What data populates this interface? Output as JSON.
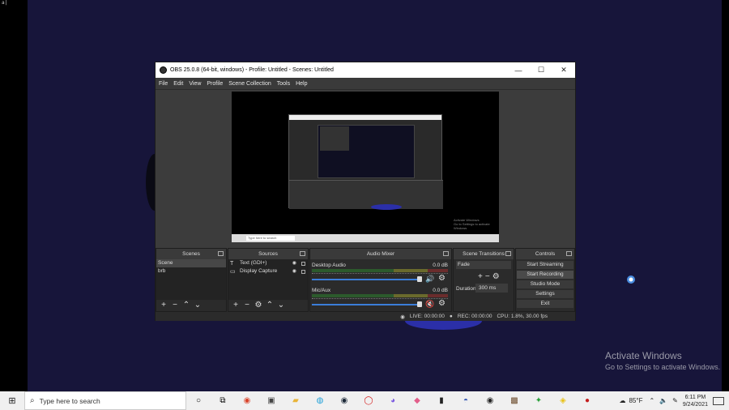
{
  "screen_corner_text": "a|",
  "window": {
    "title": "OBS 25.0.8 (64-bit, windows) - Profile: Untitled - Scenes: Untitled",
    "minimize": "—",
    "maximize": "☐",
    "close": "✕"
  },
  "menu": [
    "File",
    "Edit",
    "View",
    "Profile",
    "Scene Collection",
    "Tools",
    "Help"
  ],
  "preview": {
    "activate_line1": "Activate Windows",
    "activate_line2": "Go to Settings to activate Windows",
    "search_placeholder": "Type here to search"
  },
  "scenes": {
    "title": "Scenes",
    "items": [
      "Scene",
      "brb"
    ],
    "selected": "Scene"
  },
  "sources": {
    "title": "Sources",
    "items": [
      {
        "label": "Text (GDI+)",
        "icon": "text-icon"
      },
      {
        "label": "Display Capture",
        "icon": "monitor-icon"
      }
    ]
  },
  "mixer": {
    "title": "Audio Mixer",
    "channels": [
      {
        "name": "Desktop Audio",
        "db": "0.0 dB",
        "muted": false
      },
      {
        "name": "Mic/Aux",
        "db": "0.0 dB",
        "muted": true
      }
    ]
  },
  "transitions": {
    "title": "Scene Transitions",
    "selected": "Fade",
    "duration_label": "Duration",
    "duration_value": "300 ms"
  },
  "controls": {
    "title": "Controls",
    "buttons": [
      "Start Streaming",
      "Start Recording",
      "Studio Mode",
      "Settings",
      "Exit"
    ]
  },
  "status": {
    "live": "LIVE: 00:00:00",
    "rec": "REC: 00:00:00",
    "cpu": "CPU: 1.8%, 30.00 fps"
  },
  "desktop_watermark": {
    "line1": "Activate Windows",
    "line2": "Go to Settings to activate Windows."
  },
  "taskbar": {
    "search_placeholder": "Type here to search",
    "temperature": "85°F",
    "time": "6:11 PM",
    "date": "9/24/2021"
  },
  "colors": {
    "desktop": "#17153a",
    "obs_dark": "#2b2b2b",
    "accent_blue": "#3b7dd8",
    "muted_red": "#d43030"
  }
}
